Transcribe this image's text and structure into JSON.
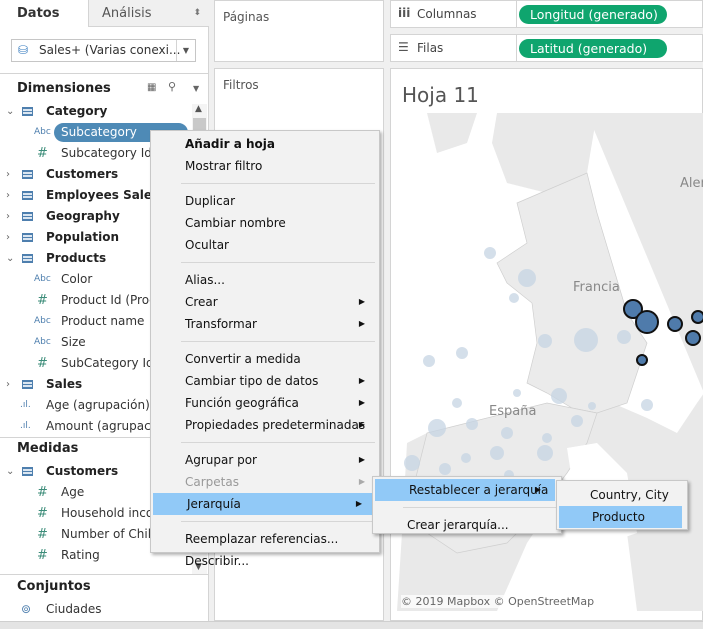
{
  "left": {
    "tabs": [
      {
        "label": "Datos"
      },
      {
        "label": "Análisis"
      }
    ],
    "datasource": "Sales+ (Varias conexi...",
    "dimensions_title": "Dimensiones",
    "dimensions": [
      {
        "label": "Category",
        "kind": "table",
        "expanded": true
      },
      {
        "label": "Subcategory",
        "kind": "abc",
        "selected": true
      },
      {
        "label": "Subcategory Id",
        "kind": "num"
      },
      {
        "label": "Customers",
        "kind": "table"
      },
      {
        "label": "Employees Sales",
        "kind": "table"
      },
      {
        "label": "Geography",
        "kind": "table"
      },
      {
        "label": "Population",
        "kind": "table"
      },
      {
        "label": "Products",
        "kind": "table",
        "expanded": true
      },
      {
        "label": "Color",
        "kind": "abc"
      },
      {
        "label": "Product Id (Proc",
        "kind": "num"
      },
      {
        "label": "Product name",
        "kind": "abc"
      },
      {
        "label": "Size",
        "kind": "abc"
      },
      {
        "label": "SubCategory Id",
        "kind": "num"
      },
      {
        "label": "Sales",
        "kind": "table"
      },
      {
        "label": "Age (agrupación)",
        "kind": "bin"
      },
      {
        "label": "Amount (agrupación)",
        "kind": "bin"
      }
    ],
    "measures_title": "Medidas",
    "measures": [
      {
        "label": "Customers",
        "kind": "table",
        "expanded": true
      },
      {
        "label": "Age",
        "kind": "num"
      },
      {
        "label": "Household income",
        "kind": "num"
      },
      {
        "label": "Number of Children",
        "kind": "num"
      },
      {
        "label": "Rating",
        "kind": "num"
      }
    ],
    "sets_title": "Conjuntos",
    "sets": [
      {
        "label": "Ciudades"
      }
    ]
  },
  "cards": {
    "pages": "Páginas",
    "filters": "Filtros"
  },
  "shelves": {
    "columns_label": "Columnas",
    "columns_pill": "Longitud (generado)",
    "rows_label": "Filas",
    "rows_pill": "Latitud (generado)"
  },
  "view": {
    "title": "Hoja 11",
    "map_labels": {
      "germany": "Alem",
      "france": "Francia",
      "spain": "España"
    },
    "attribution": "© 2019 Mapbox © OpenStreetMap"
  },
  "context_menu": [
    {
      "label": "Añadir a hoja",
      "bold": true
    },
    {
      "label": "Mostrar filtro"
    },
    {
      "sep": true
    },
    {
      "label": "Duplicar"
    },
    {
      "label": "Cambiar nombre"
    },
    {
      "label": "Ocultar"
    },
    {
      "sep": true
    },
    {
      "label": "Alias..."
    },
    {
      "label": "Crear",
      "sub": true
    },
    {
      "label": "Transformar",
      "sub": true
    },
    {
      "sep": true
    },
    {
      "label": "Convertir a medida"
    },
    {
      "label": "Cambiar tipo de datos",
      "sub": true
    },
    {
      "label": "Función geográfica",
      "sub": true
    },
    {
      "label": "Propiedades predeterminadas",
      "sub": true
    },
    {
      "sep": true
    },
    {
      "label": "Agrupar por",
      "sub": true
    },
    {
      "label": "Carpetas",
      "sub": true,
      "disabled": true
    },
    {
      "label": "Jerarquía",
      "sub": true,
      "highlight": true
    },
    {
      "sep": true
    },
    {
      "label": "Reemplazar referencias..."
    },
    {
      "label": "Describir..."
    }
  ],
  "submenu": [
    {
      "label": "Restablecer a jerarquía",
      "sub": true,
      "highlight": true
    },
    {
      "sep": true
    },
    {
      "label": "Crear jerarquía..."
    }
  ],
  "submenu2": [
    {
      "label": "Country, City"
    },
    {
      "label": "Producto",
      "highlight": true
    }
  ],
  "colors": {
    "pill": "#0fa56e",
    "selection": "#4e8ab6",
    "menu_highlight": "#91c9f7",
    "mark": "#4f7bab"
  }
}
